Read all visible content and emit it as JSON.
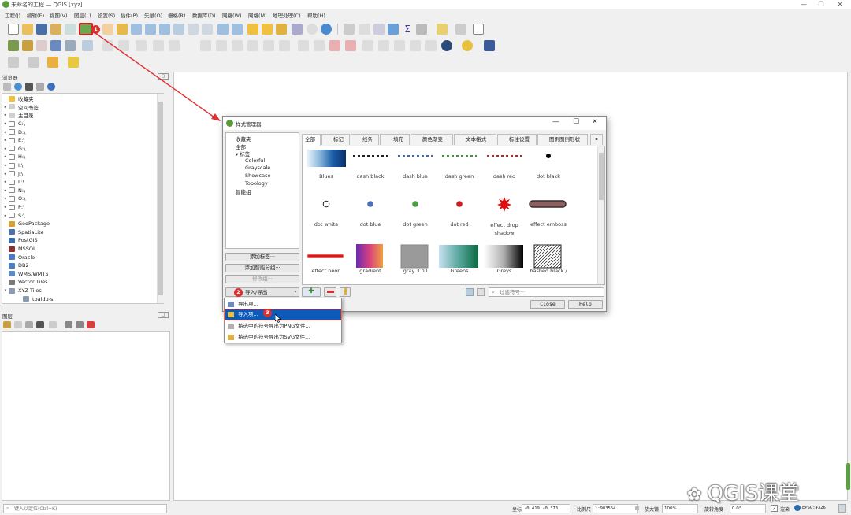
{
  "window": {
    "title": "未命名的工程 — QGIS [xyz]",
    "minimize": "—",
    "restore": "❐",
    "close": "✕"
  },
  "menus": [
    "工程(J)",
    "编辑(E)",
    "视图(V)",
    "图层(L)",
    "设置(S)",
    "插件(P)",
    "矢量(O)",
    "栅格(R)",
    "数据库(D)",
    "网络(W)",
    "网格(M)",
    "地理处理(C)",
    "帮助(H)"
  ],
  "browser": {
    "title": "浏览器",
    "items": [
      {
        "label": "收藏夹",
        "icon": "star-icon",
        "arrow": ""
      },
      {
        "label": "空间书签",
        "icon": "bookmark-icon",
        "arrow": "▸"
      },
      {
        "label": "主目录",
        "icon": "home-folder-icon",
        "arrow": "▸"
      },
      {
        "label": "C:\\",
        "icon": "drive-icon",
        "arrow": "▸"
      },
      {
        "label": "D:\\",
        "icon": "drive-icon",
        "arrow": "▸"
      },
      {
        "label": "E:\\",
        "icon": "drive-icon",
        "arrow": "▸"
      },
      {
        "label": "G:\\",
        "icon": "drive-icon",
        "arrow": "▸"
      },
      {
        "label": "H:\\",
        "icon": "drive-icon",
        "arrow": "▸"
      },
      {
        "label": "I:\\",
        "icon": "drive-icon",
        "arrow": "▸"
      },
      {
        "label": "J:\\",
        "icon": "drive-icon",
        "arrow": "▸"
      },
      {
        "label": "L:\\",
        "icon": "drive-icon",
        "arrow": "▸"
      },
      {
        "label": "N:\\",
        "icon": "drive-icon",
        "arrow": "▸"
      },
      {
        "label": "O:\\",
        "icon": "drive-icon",
        "arrow": "▸"
      },
      {
        "label": "P:\\",
        "icon": "drive-icon",
        "arrow": "▸"
      },
      {
        "label": "S:\\",
        "icon": "drive-icon",
        "arrow": "▸"
      },
      {
        "label": "GeoPackage",
        "icon": "geopackage-icon",
        "arrow": ""
      },
      {
        "label": "SpatiaLite",
        "icon": "spatialite-icon",
        "arrow": ""
      },
      {
        "label": "PostGIS",
        "icon": "postgis-icon",
        "arrow": ""
      },
      {
        "label": "MSSQL",
        "icon": "mssql-icon",
        "arrow": ""
      },
      {
        "label": "Oracle",
        "icon": "oracle-icon",
        "arrow": ""
      },
      {
        "label": "DB2",
        "icon": "db2-icon",
        "arrow": ""
      },
      {
        "label": "WMS/WMTS",
        "icon": "wms-icon",
        "arrow": ""
      },
      {
        "label": "Vector Tiles",
        "icon": "vector-tiles-icon",
        "arrow": ""
      },
      {
        "label": "XYZ Tiles",
        "icon": "xyz-tiles-icon",
        "arrow": "▾"
      },
      {
        "label": "tbaidu-s",
        "icon": "tile-layer-icon",
        "arrow": "",
        "indent": true
      }
    ]
  },
  "layers": {
    "title": "图层"
  },
  "dialog": {
    "title": "样式管理器",
    "tree": [
      {
        "label": "收藏夹",
        "indent": 0
      },
      {
        "label": "全部",
        "indent": 0
      },
      {
        "label": "▾ 标签",
        "indent": 0
      },
      {
        "label": "Colorful",
        "indent": 2
      },
      {
        "label": "Grayscale",
        "indent": 2
      },
      {
        "label": "Showcase",
        "indent": 2
      },
      {
        "label": "Topology",
        "indent": 2
      },
      {
        "label": "智能组",
        "indent": 0
      }
    ],
    "buttons": {
      "add_tag": "添加标签···",
      "add_smart_group": "添加智能分组···",
      "modify_group": "修改组···",
      "import_export": "导入/导出",
      "close": "Close",
      "help": "Help"
    },
    "tabs": [
      "全部",
      "标记",
      "线条",
      "填充",
      "颜色渐变",
      "文本格式",
      "标注设置",
      "图例图例形状"
    ],
    "tabs_arrows": "◂▸",
    "search_placeholder": "过滤符号···",
    "symbols": [
      "Blues",
      "dash  black",
      "dash blue",
      "dash green",
      "dash red",
      "dot  black",
      "dot  white",
      "dot blue",
      "dot green",
      "dot red",
      "effect drop shadow",
      "effect emboss",
      "effect neon",
      "gradient",
      "gray 3 fill",
      "Greens",
      "Greys",
      "hashed black /"
    ]
  },
  "popup": {
    "items": [
      {
        "label": "导出项...",
        "icon": "export-icon"
      },
      {
        "label": "导入项...",
        "icon": "import-folder-icon"
      },
      {
        "label": "将选中的符号导出为PNG文件...",
        "icon": "png-export-icon"
      },
      {
        "label": "将选中的符号导出为SVG文件...",
        "icon": "svg-export-icon"
      }
    ],
    "highlight_color": "#0c5bb8"
  },
  "badges": [
    "1",
    "2",
    "3"
  ],
  "status": {
    "locate_placeholder": "键入以定位(Ctrl+K)",
    "coord_label": "坐标",
    "coord_value": "-0.419,-0.373",
    "scale_label": "比例尺",
    "scale_value": "1:983554",
    "magnifier_label": "放大镜",
    "magnifier_value": "100%",
    "rotation_label": "旋转角度",
    "rotation_value": "0.0°",
    "render_label": "渲染",
    "crs": "EPSG:4326"
  },
  "watermark": "QGIS课堂"
}
